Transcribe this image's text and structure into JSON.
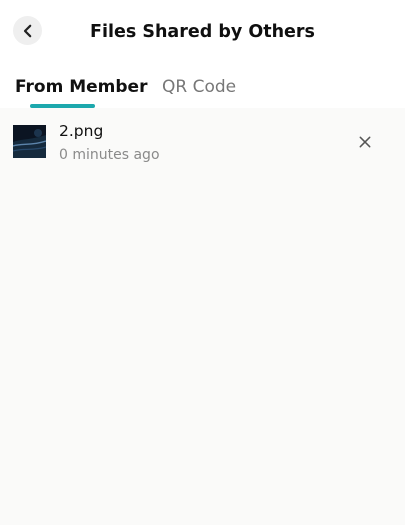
{
  "header": {
    "title": "Files Shared by Others",
    "back_icon": "chevron-left-icon"
  },
  "tabs": [
    {
      "label": "From Member",
      "active": true
    },
    {
      "label": "QR Code",
      "active": false
    }
  ],
  "files": [
    {
      "name": "2.png",
      "time": "0 minutes ago",
      "thumbnail_icon": "image-thumbnail",
      "remove_icon": "close-icon"
    }
  ],
  "colors": {
    "accent": "#1ca8ad",
    "background": "#fafaf9",
    "muted_text": "#8a8a8a"
  }
}
